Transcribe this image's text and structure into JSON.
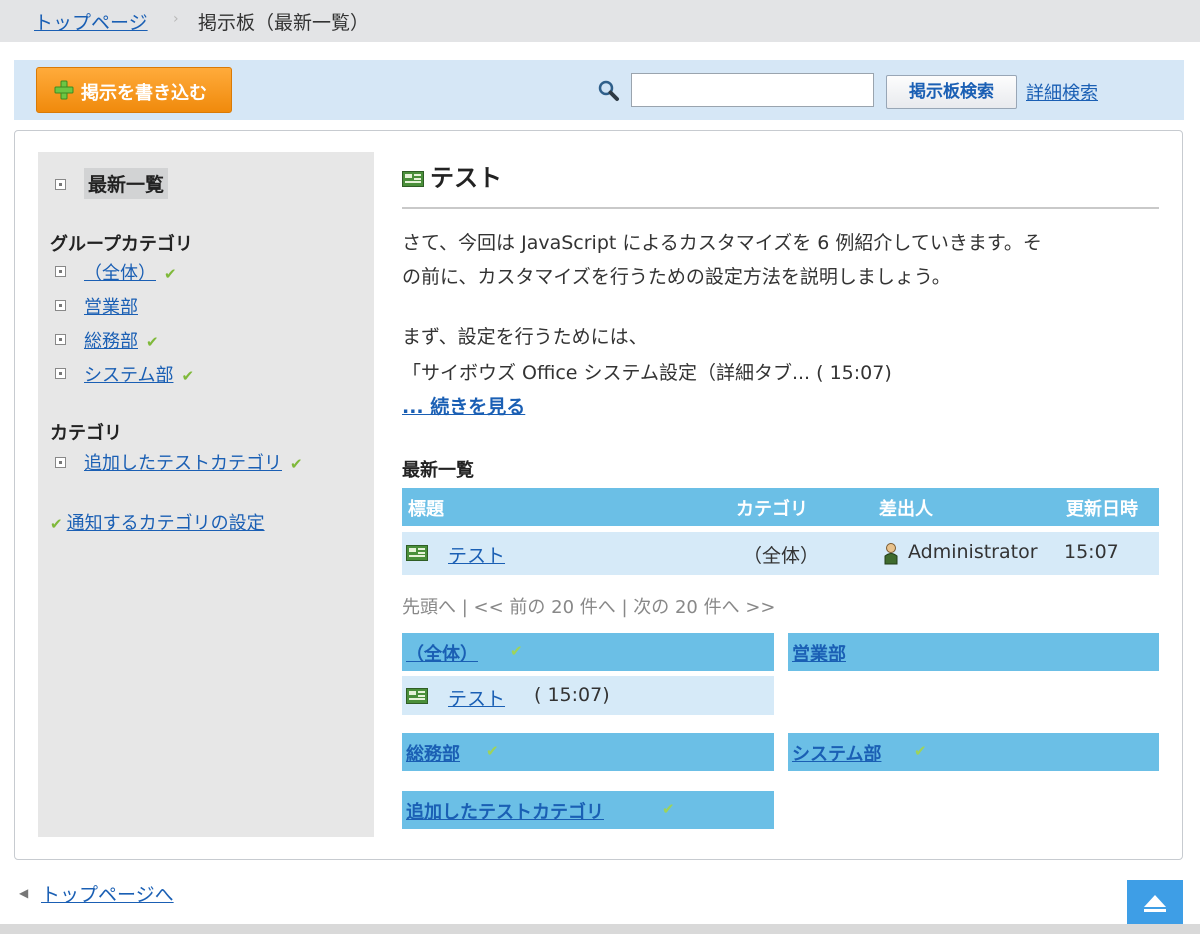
{
  "breadcrumb": {
    "top_link": "トップページ",
    "current": "掲示板（最新一覧）"
  },
  "toolbar": {
    "post_button": "掲示を書き込む",
    "search_value": "",
    "search_button": "掲示板検索",
    "detail_search": "詳細検索"
  },
  "sidebar": {
    "current": "最新一覧",
    "group_heading": "グループカテゴリ",
    "groups": [
      {
        "label": "（全体）",
        "checked": true
      },
      {
        "label": "営業部",
        "checked": false
      },
      {
        "label": "総務部",
        "checked": true
      },
      {
        "label": "システム部",
        "checked": true
      }
    ],
    "category_heading": "カテゴリ",
    "categories": [
      {
        "label": "追加したテストカテゴリ",
        "checked": true
      }
    ],
    "notify_link": "通知するカテゴリの設定",
    "check_glyph": "✔"
  },
  "article": {
    "title": "テスト",
    "line1": "さて、今回は JavaScript によるカスタマイズを 6 例紹介していきます。そ",
    "line2": "の前に、カスタマイズを行うための設定方法を説明しましょう。",
    "line3": "まず、設定を行うためには、",
    "line4": "「サイボウズ Office システム設定（詳細タブ... ( 15:07)",
    "more": "... 続きを見る"
  },
  "latest": {
    "heading": "最新一覧",
    "columns": {
      "title": "標題",
      "category": "カテゴリ",
      "sender": "差出人",
      "updated": "更新日時"
    },
    "rows": [
      {
        "title": "テスト",
        "category": "（全体）",
        "sender": "Administrator",
        "updated": "15:07"
      }
    ],
    "pager": "先頭へ | << 前の 20 件へ | 次の 20 件へ >>"
  },
  "category_boxes": [
    {
      "label": "（全体）",
      "checked": true,
      "items": [
        {
          "title": "テスト",
          "time": "( 15:07)"
        }
      ]
    },
    {
      "label": "営業部",
      "checked": false,
      "items": []
    },
    {
      "label": "総務部",
      "checked": true,
      "items": []
    },
    {
      "label": "システム部",
      "checked": true,
      "items": []
    },
    {
      "label": "追加したテストカテゴリ",
      "checked": true,
      "items": []
    }
  ],
  "footer": {
    "top_link": "トップページへ"
  },
  "colors": {
    "accent_blue": "#6bbfe6",
    "row_blue": "#d6eaf8",
    "toolbar_bg": "#d6e7f6",
    "post_orange": "#f59a16",
    "link": "#1a5fb4",
    "check_green": "#7fb93a"
  }
}
